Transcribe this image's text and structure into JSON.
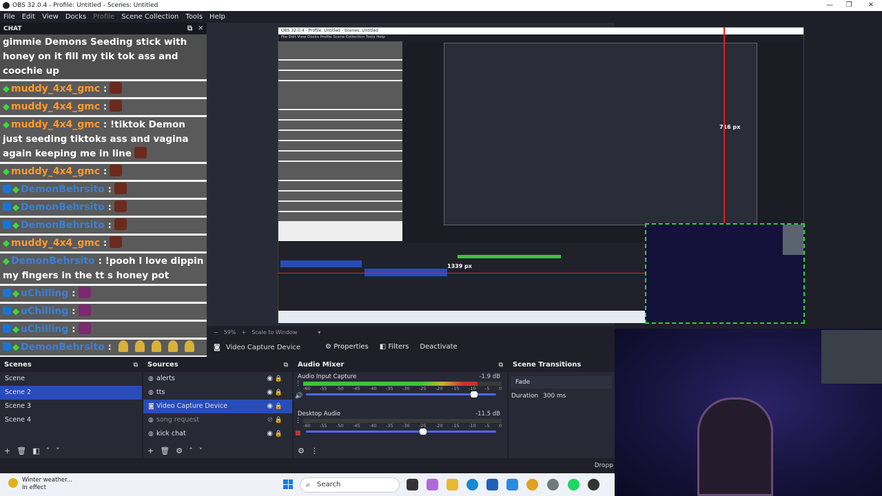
{
  "window": {
    "title": "OBS 32.0.4 - Profile: Untitled - Scenes: Untitled",
    "controls": [
      "—",
      "❐",
      "✕"
    ]
  },
  "menu": {
    "items": [
      "File",
      "Edit",
      "View",
      "Docks",
      "Profile",
      "Scene Collection",
      "Tools",
      "Help"
    ]
  },
  "chat": {
    "title": "CHAT",
    "messages": [
      {
        "text": "gimmie Demons Seeding stick with honey on it fill my tik tok ass and coochie up"
      },
      {
        "user": "muddy_4x4_gmc",
        "sep": ":",
        "text": ""
      },
      {
        "user": "muddy_4x4_gmc",
        "sep": ":",
        "text": ""
      },
      {
        "user": "muddy_4x4_gmc",
        "sep": ":",
        "text": "!tiktok Demon just seeding tiktoks ass and vagina again keeping me in line"
      },
      {
        "user": "muddy_4x4_gmc",
        "sep": ":",
        "text": ""
      },
      {
        "user": "DemonBehrsito",
        "sep": ":",
        "text": ""
      },
      {
        "user": "DemonBehrsito",
        "sep": ":",
        "text": ""
      },
      {
        "user": "DemonBehrsito",
        "sep": ":",
        "text": ""
      },
      {
        "user": "muddy_4x4_gmc",
        "sep": ":",
        "text": ""
      },
      {
        "user": "DemonBehrsito",
        "sep": ":",
        "text": "!pooh I love dippin my fingers in the tt s honey pot"
      },
      {
        "user": "uChilling",
        "sep": ":",
        "text": ""
      },
      {
        "user": "uChilling",
        "sep": ":",
        "text": ""
      },
      {
        "user": "uChilling",
        "sep": ":",
        "text": ""
      },
      {
        "user": "DemonBehrsito",
        "sep": ":",
        "text": ""
      }
    ]
  },
  "preview": {
    "zoom": "59%",
    "scale_mode": "Scale to Window",
    "nested_title": "OBS 32.0.4 - Profile: Untitled - Scenes: Untitled",
    "nested_menu": "File  Edit  View  Docks  Profile  Scene Collection  Tools  Help",
    "nested_px_label": "1339 px",
    "nested_px_label2": "716 px"
  },
  "controls": {
    "source_name": "Video Capture Device",
    "properties": "Properties",
    "filters": "Filters",
    "deactivate": "Deactivate"
  },
  "scenes": {
    "title": "Scenes",
    "items": [
      "Scene",
      "Scene 2",
      "Scene 3",
      "Scene 4"
    ],
    "selected": 1
  },
  "sources": {
    "title": "Sources",
    "items": [
      {
        "name": "alerts",
        "visible": true
      },
      {
        "name": "tts",
        "visible": true
      },
      {
        "name": "Video Capture Device",
        "visible": true
      },
      {
        "name": "song request",
        "visible": false
      },
      {
        "name": "kick chat",
        "visible": true
      }
    ],
    "selected": 2
  },
  "mixer": {
    "title": "Audio Mixer",
    "tracks": [
      {
        "name": "Audio Input Capture",
        "db": "-1.9 dB",
        "level": 0.88,
        "volume": 0.9
      },
      {
        "name": "Desktop Audio",
        "db": "-11.5 dB",
        "level": 0.0,
        "volume": 0.62
      }
    ],
    "ticks": [
      "-60",
      "-55",
      "-50",
      "-45",
      "-40",
      "-35",
      "-30",
      "-25",
      "-20",
      "-15",
      "-10",
      "-5",
      "0"
    ]
  },
  "transitions": {
    "title": "Scene Transitions",
    "type": "Fade",
    "duration_label": "Duration",
    "duration_value": "300 ms"
  },
  "status": {
    "dropped": "Dropp"
  },
  "taskbar": {
    "weather_title": "Winter weather...",
    "weather_sub": "In effect",
    "search_placeholder": "Search"
  },
  "colors": {
    "accent": "#284cb8",
    "meter_green": "#3cc43c",
    "meter_yellow": "#c8b430",
    "meter_red": "#c83232",
    "chat_orange": "#ff9a2e",
    "chat_blue": "#3c7fd6"
  }
}
